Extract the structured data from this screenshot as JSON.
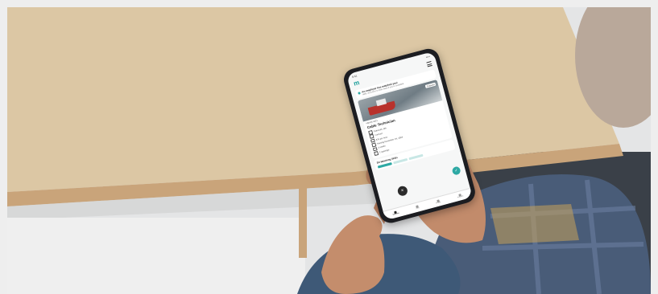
{
  "scene": {
    "description_colors": {
      "table": "#dcc6a3",
      "table_edge": "#c7a37a",
      "wall": "#e6e6e6",
      "shirt": "#4a5d78",
      "skin": "#c48d6c"
    }
  },
  "phone": {
    "status_time": "9:41",
    "status_icons": "▪▪ ▪",
    "logo": "m",
    "banner": {
      "title": "An employer has matched you!",
      "text": "Well, we'd love to hear back if you're available."
    },
    "card": {
      "tag": "Featured",
      "job_id": "#88-04-4321",
      "title": "Cable Technician",
      "details": [
        "Falmouth, MA",
        "Contract",
        "$75 per hour",
        "Starting November 1st, 2024",
        "3 weeks",
        "2 openings"
      ]
    },
    "skills": {
      "title": "3/4 Matching Skills"
    },
    "fab_close": "×",
    "fab_check": "✓",
    "tabs": [
      {
        "label": "Matches"
      },
      {
        "label": "Jobs"
      },
      {
        "label": "Profile"
      },
      {
        "label": "Account"
      }
    ]
  }
}
